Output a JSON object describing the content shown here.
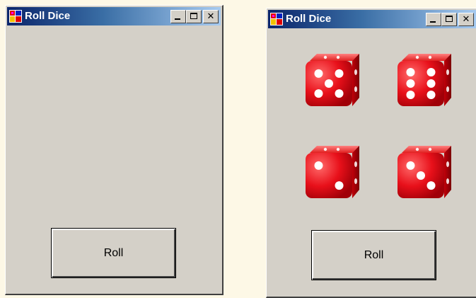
{
  "windows": [
    {
      "title": "Roll Dice",
      "button_label": "Roll",
      "dice": []
    },
    {
      "title": "Roll Dice",
      "button_label": "Roll",
      "dice": [
        5,
        6,
        2,
        3
      ]
    }
  ],
  "icons": {
    "app": "app-window-icon",
    "minimize": "minimize-icon",
    "maximize": "maximize-icon",
    "close": "close-icon"
  },
  "colors": {
    "die_red": "#e8101a",
    "die_pip": "#ffffff",
    "window_face": "#d4d0c8",
    "title_start": "#0a246a",
    "title_end": "#a6caf0"
  }
}
